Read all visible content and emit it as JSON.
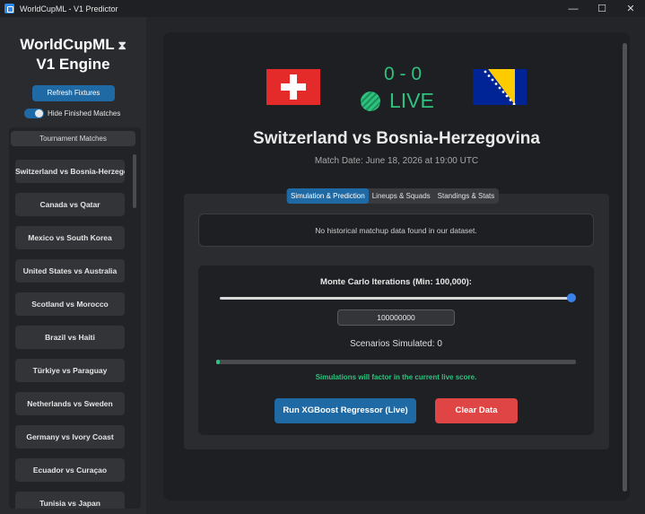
{
  "window": {
    "title": "WorldCupML - V1 Predictor",
    "minimize": "—",
    "maximize": "☐",
    "close": "✕"
  },
  "sidebar": {
    "logo_line1": "WorldCupML",
    "logo_line2": "V1 Engine",
    "refresh_label": "Refresh Fixtures",
    "toggle_label": "Hide Finished Matches",
    "toggle_on": true,
    "panel_title": "Tournament Matches",
    "matches": [
      "Switzerland vs Bosnia-Herzegovina",
      "Canada vs Qatar",
      "Mexico vs South Korea",
      "United States vs Australia",
      "Scotland vs Morocco",
      "Brazil vs Haiti",
      "Türkiye vs Paraguay",
      "Netherlands vs Sweden",
      "Germany vs Ivory Coast",
      "Ecuador vs Curaçao",
      "Tunisia vs Japan"
    ]
  },
  "match": {
    "score": "0 - 0",
    "status": "LIVE",
    "home_flag": "switzerland-flag",
    "away_flag": "bosnia-herzegovina-flag",
    "title": "Switzerland vs Bosnia-Herzegovina",
    "date": "Match Date: June 18, 2026 at 19:00 UTC"
  },
  "tabs": [
    "Simulation & Prediction",
    "Lineups & Squads",
    "Standings & Stats"
  ],
  "active_tab": 0,
  "simulation": {
    "history_message": "No historical matchup data found in our dataset.",
    "iterations_label": "Monte Carlo Iterations (Min: 100,000):",
    "iterations_value": "100000000",
    "slider_fraction": 1.0,
    "scenarios_label": "Scenarios Simulated: 0",
    "progress_fraction": 0.01,
    "note": "Simulations will factor in the current live score.",
    "run_label": "Run XGBoost Regressor (Live)",
    "clear_label": "Clear Data"
  },
  "colors": {
    "accent": "#1f6aa5",
    "live_green": "#2ec27e",
    "danger": "#e04545"
  }
}
